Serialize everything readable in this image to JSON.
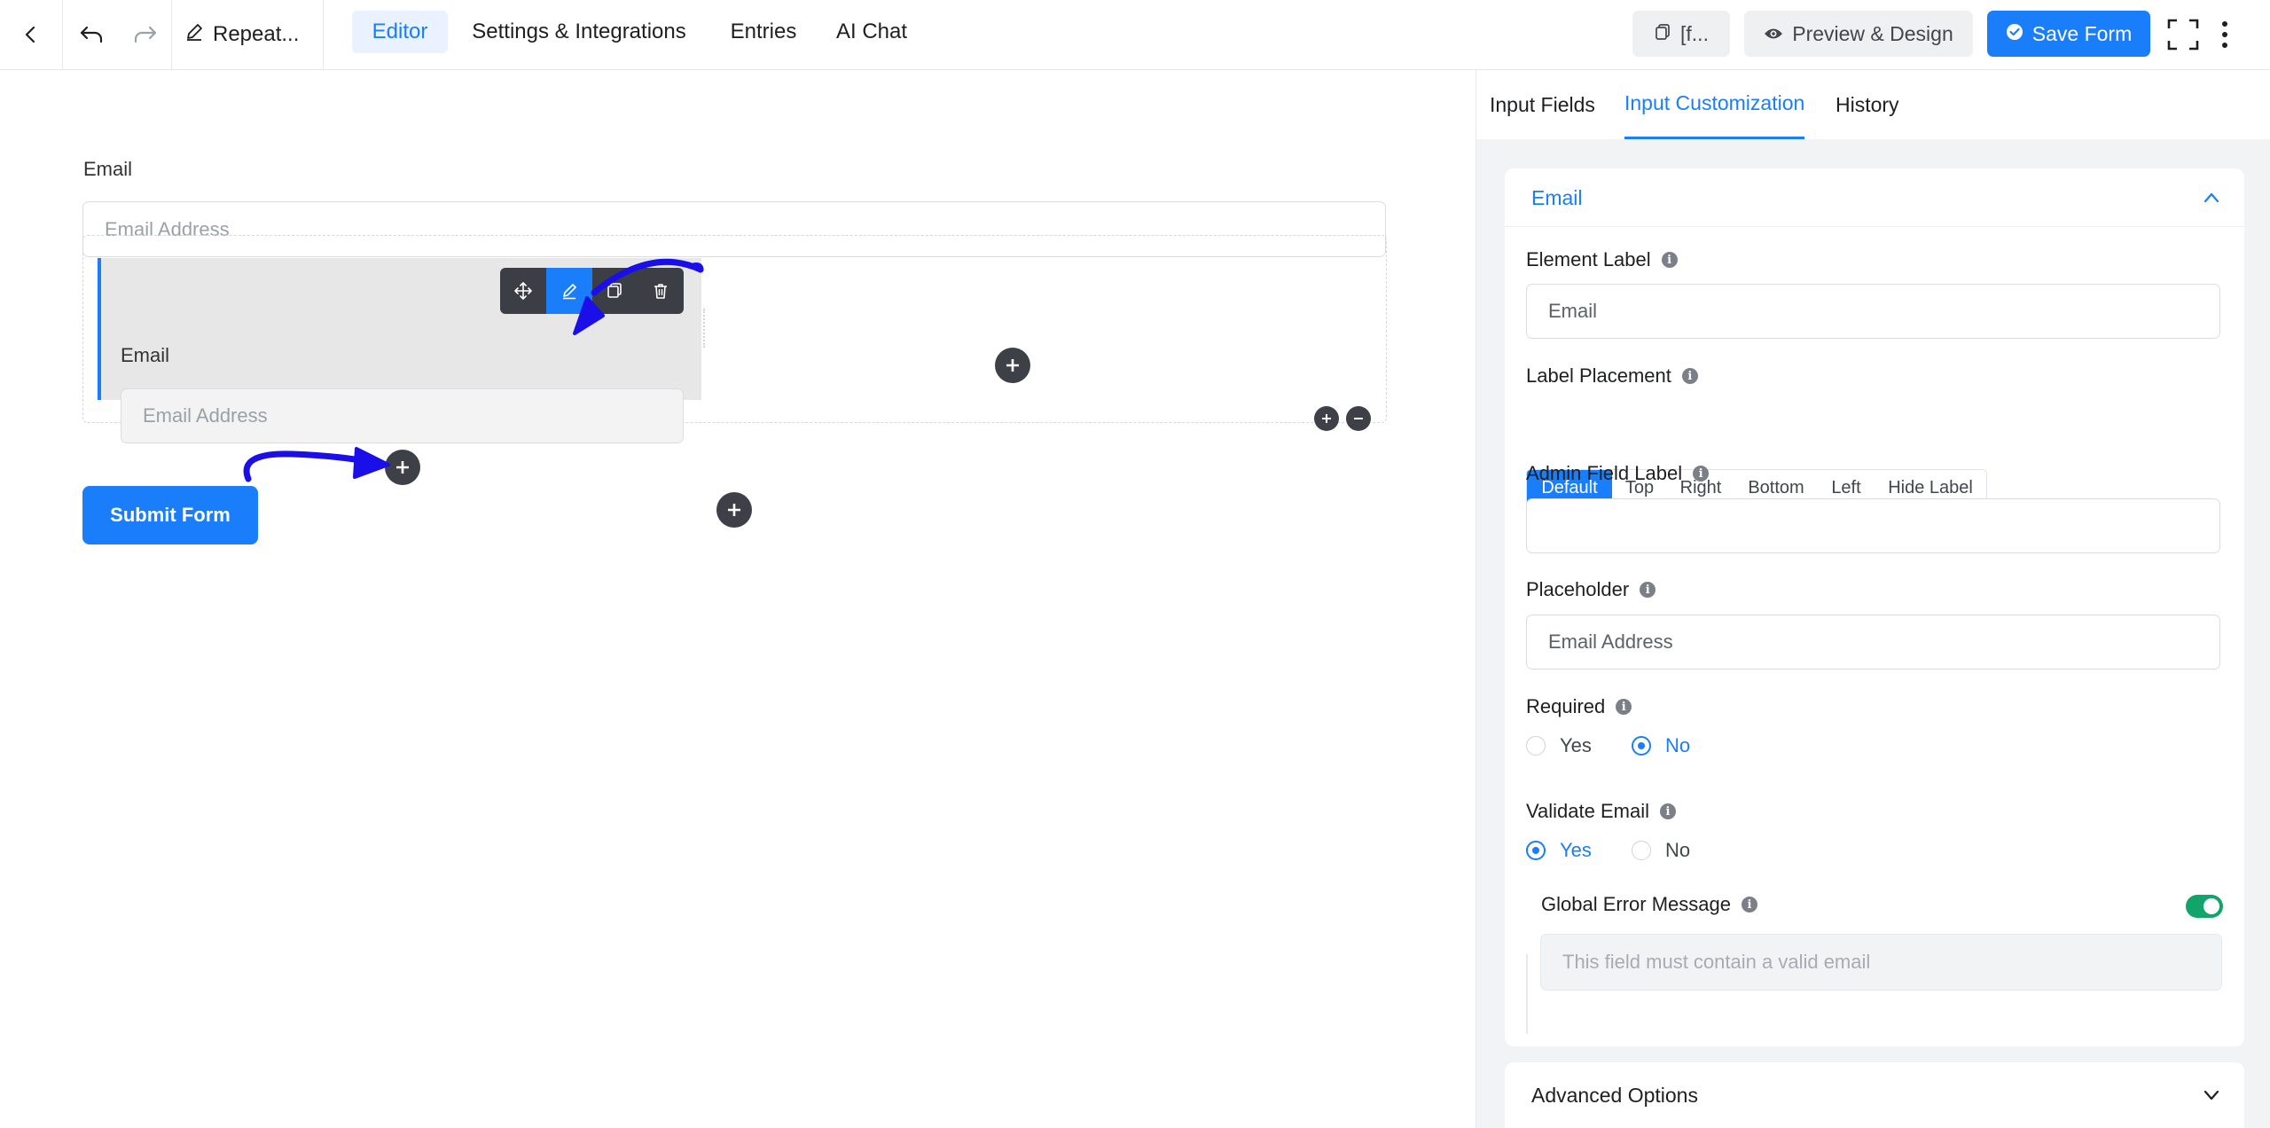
{
  "topbar": {
    "form_name": "Repeat...",
    "tabs": [
      {
        "label": "Editor",
        "active": true
      },
      {
        "label": "Settings & Integrations",
        "active": false
      },
      {
        "label": "Entries",
        "active": false
      },
      {
        "label": "AI Chat",
        "active": false
      }
    ],
    "shortcode_label": "[f...",
    "preview_label": "Preview & Design",
    "save_label": "Save Form"
  },
  "canvas": {
    "field1": {
      "label": "Email",
      "placeholder": "Email Address"
    },
    "field2": {
      "label": "Email",
      "placeholder": "Email Address"
    },
    "submit_label": "Submit Form"
  },
  "panel": {
    "tabs": [
      {
        "label": "Input Fields",
        "active": false
      },
      {
        "label": "Input Customization",
        "active": true
      },
      {
        "label": "History",
        "active": false
      }
    ],
    "section_title": "Email",
    "element_label": {
      "label": "Element Label",
      "value": "Email"
    },
    "label_placement": {
      "label": "Label Placement",
      "options": [
        "Default",
        "Top",
        "Right",
        "Bottom",
        "Left",
        "Hide Label"
      ],
      "selected": "Default"
    },
    "admin_field_label": {
      "label": "Admin Field Label",
      "value": ""
    },
    "placeholder": {
      "label": "Placeholder",
      "value": "Email Address"
    },
    "required": {
      "label": "Required",
      "options": [
        "Yes",
        "No"
      ],
      "selected": "No"
    },
    "validate_email": {
      "label": "Validate Email",
      "options": [
        "Yes",
        "No"
      ],
      "selected": "Yes"
    },
    "global_error": {
      "label": "Global Error Message",
      "enabled": true,
      "placeholder": "This field must contain a valid email"
    },
    "advanced_options": "Advanced Options"
  },
  "colors": {
    "accent": "#1a7efb",
    "toggle_on": "#12a56b",
    "annotation_arrow": "#1a0fe8"
  }
}
